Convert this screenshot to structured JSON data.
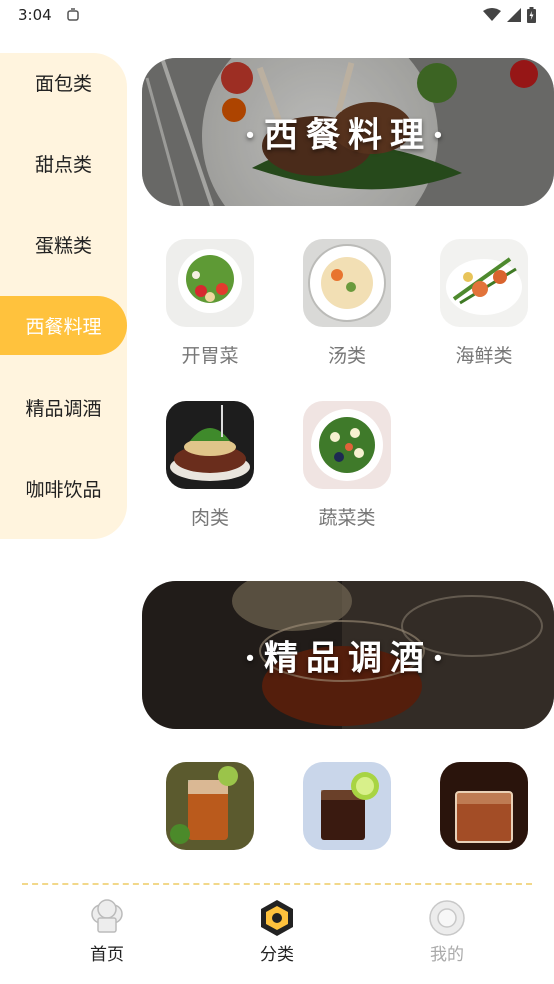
{
  "status": {
    "time": "3:04"
  },
  "sidebar": {
    "items": [
      {
        "label": "面包类"
      },
      {
        "label": "甜点类"
      },
      {
        "label": "蛋糕类"
      },
      {
        "label": "西餐料理",
        "active": true
      },
      {
        "label": "精品调酒"
      },
      {
        "label": "咖啡饮品"
      }
    ]
  },
  "sections": [
    {
      "banner_title": "·西餐料理·",
      "items": [
        {
          "label": "开胃菜"
        },
        {
          "label": "汤类"
        },
        {
          "label": "海鲜类"
        },
        {
          "label": "肉类"
        },
        {
          "label": "蔬菜类"
        }
      ]
    },
    {
      "banner_title": "·精品调酒·",
      "items": [
        {
          "label": ""
        },
        {
          "label": ""
        },
        {
          "label": ""
        }
      ]
    }
  ],
  "bottom_nav": [
    {
      "label": "首页",
      "icon": "chef-hat-icon"
    },
    {
      "label": "分类",
      "icon": "hexagon-category-icon",
      "active": true
    },
    {
      "label": "我的",
      "icon": "profile-icon"
    }
  ],
  "colors": {
    "accent": "#ffc23d",
    "sidebar_bg": "#fff4de",
    "divider": "#f2d88a"
  }
}
